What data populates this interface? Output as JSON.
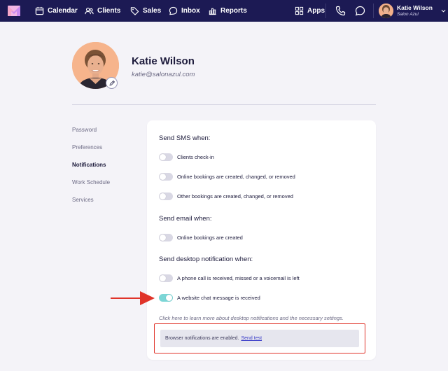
{
  "nav": {
    "items": [
      {
        "label": "Calendar",
        "icon": "calendar-icon"
      },
      {
        "label": "Clients",
        "icon": "clients-icon"
      },
      {
        "label": "Sales",
        "icon": "tag-icon"
      },
      {
        "label": "Inbox",
        "icon": "inbox-icon"
      },
      {
        "label": "Reports",
        "icon": "reports-icon"
      }
    ],
    "apps_label": "Apps",
    "user_name": "Katie Wilson",
    "user_salon": "Salon Azul"
  },
  "profile": {
    "name": "Katie Wilson",
    "email": "katie@salonazul.com"
  },
  "side_menu": {
    "items": [
      "Password",
      "Preferences",
      "Notifications",
      "Work Schedule",
      "Services"
    ],
    "active": "Notifications"
  },
  "sms": {
    "title": "Send SMS when:",
    "options": [
      {
        "label": "Clients check-in",
        "on": false
      },
      {
        "label": "Online bookings are created, changed, or removed",
        "on": false
      },
      {
        "label": "Other bookings are created, changed, or removed",
        "on": false
      }
    ]
  },
  "email": {
    "title": "Send email when:",
    "options": [
      {
        "label": "Online bookings are created",
        "on": false
      }
    ]
  },
  "desktop": {
    "title": "Send desktop notification when:",
    "options": [
      {
        "label": "A phone call is received, missed or a voicemail is left",
        "on": false
      },
      {
        "label": "A website chat message is received",
        "on": true
      }
    ]
  },
  "info_link": "Click here to learn more about desktop notifications and the necessary settings.",
  "notice": {
    "text": "Browser notifications are enabled.",
    "link": "Send test"
  },
  "colors": {
    "nav_bg": "#1c1a54",
    "toggle_on": "#7cd6d6",
    "highlight": "#e0342a",
    "link": "#3a3cc8"
  }
}
